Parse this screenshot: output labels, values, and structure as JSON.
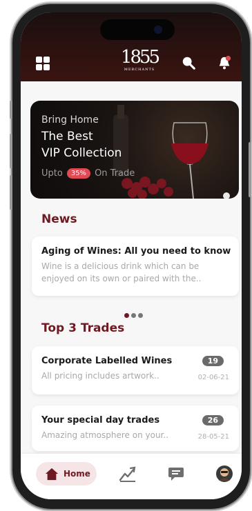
{
  "header": {
    "logo_number": "1855",
    "logo_sub": "MERCHANTS"
  },
  "banner": {
    "line1": "Bring Home",
    "line2": "The Best",
    "line3": "VIP Collection",
    "upto": "Upto",
    "percent": "35%",
    "on_trade": "On Trade"
  },
  "news": {
    "title": "News",
    "items": [
      {
        "title": "Aging of Wines: All you need to know",
        "desc_line1": "Wine is a delicious drink which can be",
        "desc_line2": "enjoyed on its own or paired with the.."
      }
    ],
    "carousel_pages": 3,
    "carousel_active": 1
  },
  "trades": {
    "title": "Top 3 Trades",
    "items": [
      {
        "title": "Corporate Labelled Wines",
        "desc": "All pricing includes artwork..",
        "count": "19",
        "date": "02-06-21"
      },
      {
        "title": "Your special day trades",
        "desc": "Amazing atmosphere on your..",
        "count": "26",
        "date": "28-05-21"
      }
    ]
  },
  "tabbar": {
    "home_label": "Home"
  },
  "colors": {
    "brand": "#6e1a22",
    "accent_badge": "#e04a53",
    "notification_dot": "#e04a53"
  },
  "icons": [
    "grid-icon",
    "search-icon",
    "bell-icon",
    "home-icon",
    "trade-chart-icon",
    "chat-icon",
    "avatar"
  ]
}
